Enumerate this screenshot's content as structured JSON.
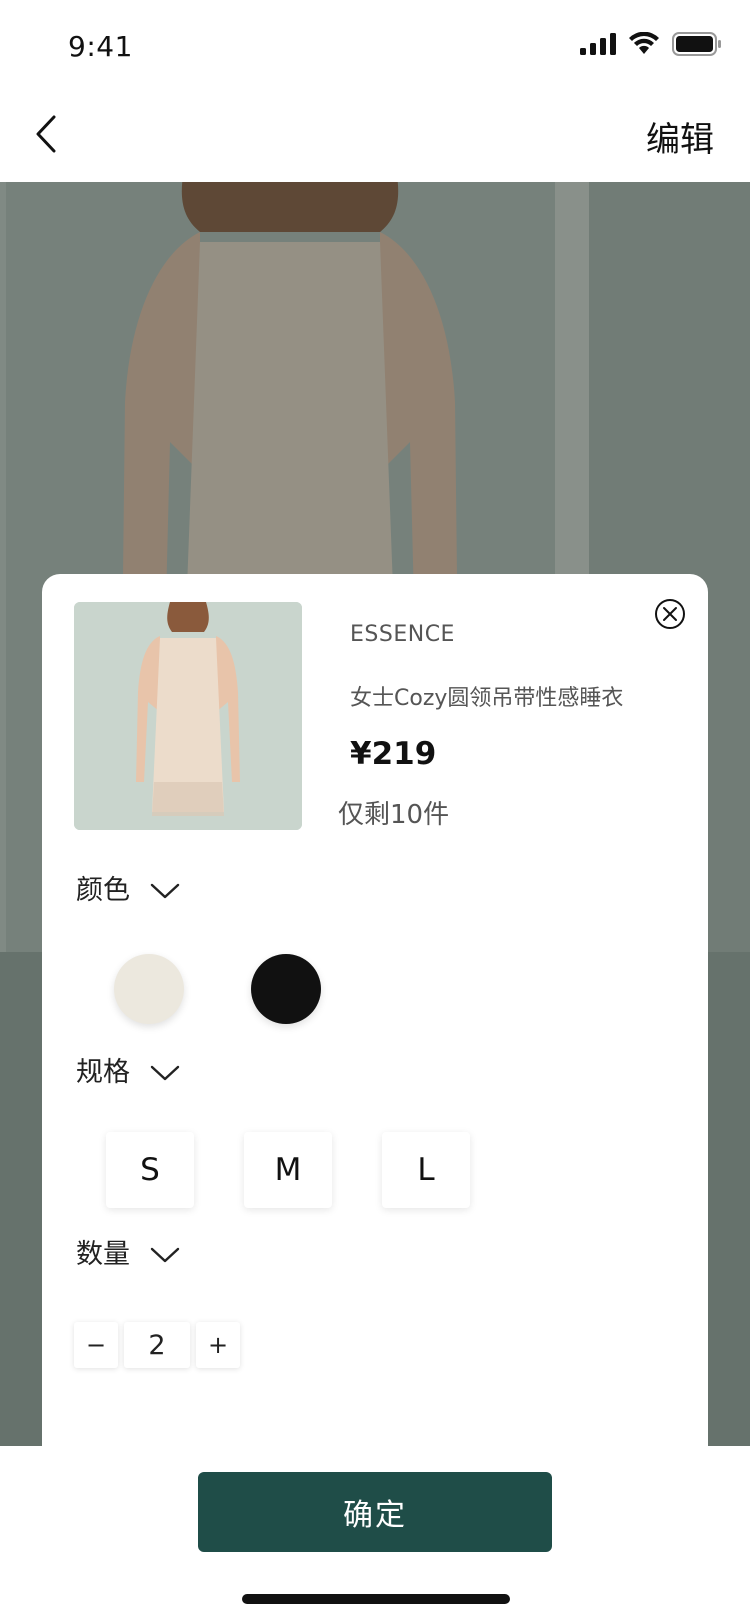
{
  "status_bar": {
    "time": "9:41",
    "icons": [
      "signal-icon",
      "wifi-icon",
      "battery-icon"
    ]
  },
  "nav": {
    "back_icon": "chevron-left-icon",
    "edit_label": "编辑"
  },
  "product": {
    "brand": "ESSENCE",
    "name": "女士Cozy圆领吊带性感睡衣",
    "price": "¥219",
    "stock": "仅剩10件",
    "close_icon": "close-circle-icon"
  },
  "color_section": {
    "title": "颜色",
    "swatches": [
      {
        "name": "cream",
        "color": "#ece8de"
      },
      {
        "name": "black",
        "color": "#111111"
      }
    ]
  },
  "size_section": {
    "title": "规格",
    "options": [
      "S",
      "M",
      "L"
    ]
  },
  "quantity_section": {
    "title": "数量",
    "minus": "−",
    "value": "2",
    "plus": "+"
  },
  "confirm_label": "确定",
  "colors": {
    "accent": "#1f4d48",
    "text": "#222222",
    "muted": "#555555"
  }
}
